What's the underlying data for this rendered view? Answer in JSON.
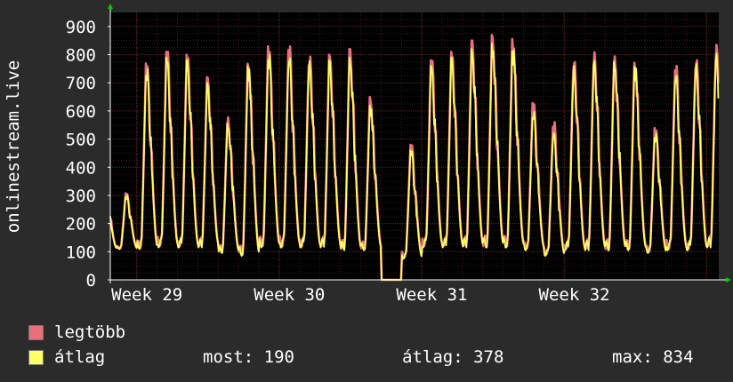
{
  "chart_data": {
    "type": "line",
    "title": "",
    "xlabel": "",
    "ylabel": "onlinestream.live",
    "ylim": [
      0,
      950
    ],
    "yticks": [
      0,
      100,
      200,
      300,
      400,
      500,
      600,
      700,
      800,
      900
    ],
    "x_tick_labels": [
      "Week 29",
      "Week 30",
      "Week 31",
      "Week 32"
    ],
    "grid": true,
    "legend_position": "bottom-left",
    "x_unit": "day (week 29 starts at day 1)",
    "x_range": [
      -0.3,
      29.6
    ],
    "series": [
      {
        "name": "legtöbb",
        "color": "#e8707a",
        "daily_peaks": [
          770,
          810,
          800,
          720,
          580,
          780,
          830,
          830,
          800,
          800,
          820,
          650,
          0,
          480,
          780,
          810,
          850,
          870,
          860,
          630,
          560,
          790,
          810,
          800,
          780,
          540,
          760,
          790,
          840
        ],
        "daily_lows": [
          110,
          120,
          120,
          120,
          100,
          90,
          120,
          120,
          120,
          120,
          110,
          110,
          0,
          80,
          120,
          120,
          120,
          120,
          120,
          110,
          90,
          110,
          110,
          110,
          110,
          100,
          110,
          110,
          120
        ]
      },
      {
        "name": "átlag",
        "color": "#ffff66",
        "daily_peaks": [
          750,
          790,
          780,
          700,
          560,
          760,
          800,
          800,
          780,
          780,
          790,
          620,
          0,
          460,
          760,
          790,
          820,
          840,
          820,
          600,
          530,
          760,
          790,
          780,
          760,
          520,
          740,
          770,
          810
        ],
        "daily_lows": [
          110,
          115,
          115,
          115,
          95,
          85,
          115,
          115,
          115,
          115,
          105,
          105,
          0,
          75,
          115,
          115,
          115,
          115,
          115,
          105,
          85,
          105,
          105,
          105,
          105,
          95,
          105,
          105,
          115
        ]
      }
    ]
  },
  "legend": {
    "max_label": "legtöbb",
    "avg_label": "átlag",
    "stats": {
      "current": "most: 190",
      "average": "átlag: 378",
      "maximum": "max: 834"
    }
  },
  "colors": {
    "background": "#2b2b2b",
    "plot_background": "#000000",
    "grid_major": "#5a2a2a",
    "axis": "#ffffff",
    "arrow": "#00cc00"
  }
}
